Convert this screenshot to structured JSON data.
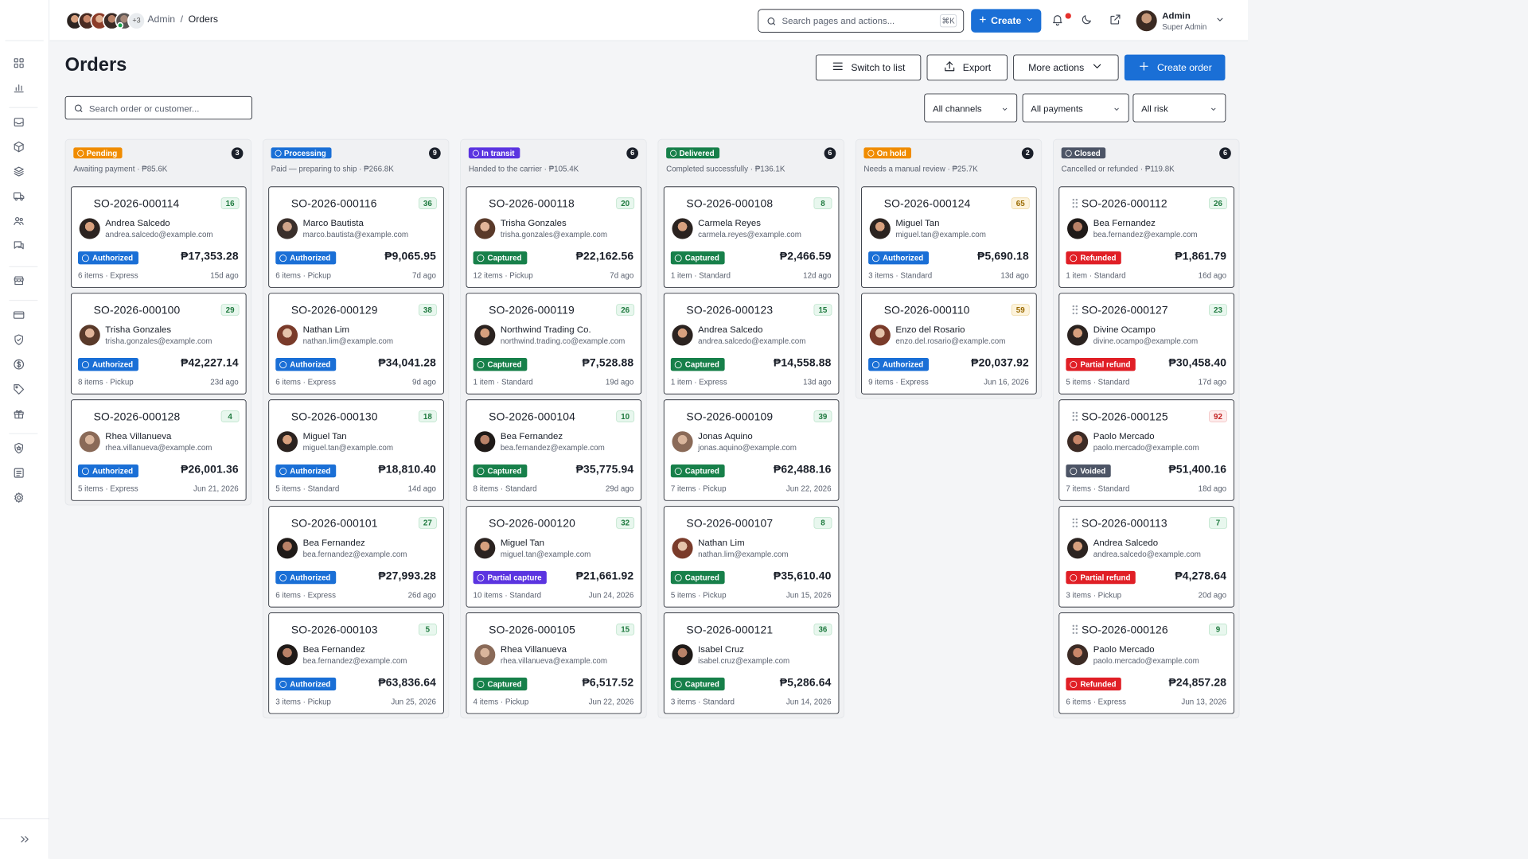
{
  "breadcrumb": {
    "root": "Admin",
    "sep": "/",
    "current": "Orders"
  },
  "avatars": {
    "more": "+3"
  },
  "search": {
    "placeholder": "Search pages and actions...",
    "shortcut": "⌘K"
  },
  "create_button": "Create",
  "user": {
    "name": "Admin",
    "role": "Super Admin"
  },
  "page": {
    "title": "Orders"
  },
  "actions": {
    "switch": "Switch to list",
    "export": "Export",
    "more": "More actions",
    "create_order": "Create order"
  },
  "order_search": {
    "placeholder": "Search order or customer..."
  },
  "filters": {
    "channels": "All channels",
    "payments": "All payments",
    "risk": "All risk"
  },
  "colors": {
    "primary": "#1a6fd6",
    "pending": "#f08c00",
    "processing": "#1a6fd6",
    "in_transit": "#5b34e0",
    "delivered": "#17804a",
    "on_hold": "#f08c00",
    "closed": "#4d5566"
  },
  "columns": [
    {
      "status": "Pending",
      "count": "3",
      "subtitle": "Awaiting payment · ₱85.6K",
      "cards": [
        {
          "id": "SO-2026-000114",
          "score": "16",
          "name": "Andrea Salcedo",
          "email": "andrea.salcedo@example.com",
          "payment": "Authorized",
          "amount": "₱17,353.28",
          "meta": "6 items · Express",
          "age": "15d ago"
        },
        {
          "id": "SO-2026-000100",
          "score": "29",
          "name": "Trisha Gonzales",
          "email": "trisha.gonzales@example.com",
          "payment": "Authorized",
          "amount": "₱42,227.14",
          "meta": "8 items · Pickup",
          "age": "23d ago"
        },
        {
          "id": "SO-2026-000128",
          "score": "4",
          "name": "Rhea Villanueva",
          "email": "rhea.villanueva@example.com",
          "payment": "Authorized",
          "amount": "₱26,001.36",
          "meta": "5 items · Express",
          "age": "Jun 21, 2026"
        }
      ]
    },
    {
      "status": "Processing",
      "count": "9",
      "subtitle": "Paid — preparing to ship · ₱266.8K",
      "cards": [
        {
          "id": "SO-2026-000116",
          "score": "36",
          "name": "Marco Bautista",
          "email": "marco.bautista@example.com",
          "payment": "Authorized",
          "amount": "₱9,065.95",
          "meta": "6 items · Pickup",
          "age": "7d ago"
        },
        {
          "id": "SO-2026-000129",
          "score": "38",
          "name": "Nathan Lim",
          "email": "nathan.lim@example.com",
          "payment": "Authorized",
          "amount": "₱34,041.28",
          "meta": "6 items · Express",
          "age": "9d ago"
        },
        {
          "id": "SO-2026-000130",
          "score": "18",
          "name": "Miguel Tan",
          "email": "miguel.tan@example.com",
          "payment": "Authorized",
          "amount": "₱18,810.40",
          "meta": "5 items · Standard",
          "age": "14d ago"
        },
        {
          "id": "SO-2026-000101",
          "score": "27",
          "name": "Bea Fernandez",
          "email": "bea.fernandez@example.com",
          "payment": "Authorized",
          "amount": "₱27,993.28",
          "meta": "6 items · Express",
          "age": "26d ago"
        },
        {
          "id": "SO-2026-000103",
          "score": "5",
          "name": "Bea Fernandez",
          "email": "bea.fernandez@example.com",
          "payment": "Authorized",
          "amount": "₱63,836.64",
          "meta": "3 items · Pickup",
          "age": "Jun 25, 2026"
        }
      ]
    },
    {
      "status": "In transit",
      "count": "6",
      "subtitle": "Handed to the carrier · ₱105.4K",
      "cards": [
        {
          "id": "SO-2026-000118",
          "score": "20",
          "name": "Trisha Gonzales",
          "email": "trisha.gonzales@example.com",
          "payment": "Captured",
          "amount": "₱22,162.56",
          "meta": "12 items · Pickup",
          "age": "7d ago"
        },
        {
          "id": "SO-2026-000119",
          "score": "26",
          "name": "Northwind Trading Co.",
          "email": "northwind.trading.co@example.com",
          "payment": "Captured",
          "amount": "₱7,528.88",
          "meta": "1 item · Standard",
          "age": "19d ago"
        },
        {
          "id": "SO-2026-000104",
          "score": "10",
          "name": "Bea Fernandez",
          "email": "bea.fernandez@example.com",
          "payment": "Captured",
          "amount": "₱35,775.94",
          "meta": "8 items · Standard",
          "age": "29d ago"
        },
        {
          "id": "SO-2026-000120",
          "score": "32",
          "name": "Miguel Tan",
          "email": "miguel.tan@example.com",
          "payment": "Partial capture",
          "amount": "₱21,661.92",
          "meta": "10 items · Standard",
          "age": "Jun 24, 2026"
        },
        {
          "id": "SO-2026-000105",
          "score": "15",
          "name": "Rhea Villanueva",
          "email": "rhea.villanueva@example.com",
          "payment": "Captured",
          "amount": "₱6,517.52",
          "meta": "4 items · Pickup",
          "age": "Jun 22, 2026"
        }
      ]
    },
    {
      "status": "Delivered",
      "count": "6",
      "subtitle": "Completed successfully · ₱136.1K",
      "cards": [
        {
          "id": "SO-2026-000108",
          "score": "8",
          "name": "Carmela Reyes",
          "email": "carmela.reyes@example.com",
          "payment": "Captured",
          "amount": "₱2,466.59",
          "meta": "1 item · Standard",
          "age": "12d ago"
        },
        {
          "id": "SO-2026-000123",
          "score": "15",
          "name": "Andrea Salcedo",
          "email": "andrea.salcedo@example.com",
          "payment": "Captured",
          "amount": "₱14,558.88",
          "meta": "1 item · Express",
          "age": "13d ago"
        },
        {
          "id": "SO-2026-000109",
          "score": "39",
          "name": "Jonas Aquino",
          "email": "jonas.aquino@example.com",
          "payment": "Captured",
          "amount": "₱62,488.16",
          "meta": "7 items · Pickup",
          "age": "Jun 22, 2026"
        },
        {
          "id": "SO-2026-000107",
          "score": "8",
          "name": "Nathan Lim",
          "email": "nathan.lim@example.com",
          "payment": "Captured",
          "amount": "₱35,610.40",
          "meta": "5 items · Pickup",
          "age": "Jun 15, 2026"
        },
        {
          "id": "SO-2026-000121",
          "score": "36",
          "name": "Isabel Cruz",
          "email": "isabel.cruz@example.com",
          "payment": "Captured",
          "amount": "₱5,286.64",
          "meta": "3 items · Standard",
          "age": "Jun 14, 2026"
        }
      ]
    },
    {
      "status": "On hold",
      "count": "2",
      "subtitle": "Needs a manual review · ₱25.7K",
      "cards": [
        {
          "id": "SO-2026-000124",
          "score": "65",
          "name": "Miguel Tan",
          "email": "miguel.tan@example.com",
          "payment": "Authorized",
          "amount": "₱5,690.18",
          "meta": "3 items · Standard",
          "age": "13d ago"
        },
        {
          "id": "SO-2026-000110",
          "score": "59",
          "name": "Enzo del Rosario",
          "email": "enzo.del.rosario@example.com",
          "payment": "Authorized",
          "amount": "₱20,037.92",
          "meta": "9 items · Express",
          "age": "Jun 16, 2026"
        }
      ]
    },
    {
      "status": "Closed",
      "count": "6",
      "subtitle": "Cancelled or refunded · ₱119.8K",
      "cards": [
        {
          "id": "SO-2026-000112",
          "score": "26",
          "name": "Bea Fernandez",
          "email": "bea.fernandez@example.com",
          "payment": "Refunded",
          "amount": "₱1,861.79",
          "meta": "1 item · Standard",
          "age": "16d ago"
        },
        {
          "id": "SO-2026-000127",
          "score": "23",
          "name": "Divine Ocampo",
          "email": "divine.ocampo@example.com",
          "payment": "Partial refund",
          "amount": "₱30,458.40",
          "meta": "5 items · Standard",
          "age": "17d ago"
        },
        {
          "id": "SO-2026-000125",
          "score": "92",
          "name": "Paolo Mercado",
          "email": "paolo.mercado@example.com",
          "payment": "Voided",
          "amount": "₱51,400.16",
          "meta": "7 items · Standard",
          "age": "18d ago"
        },
        {
          "id": "SO-2026-000113",
          "score": "7",
          "name": "Andrea Salcedo",
          "email": "andrea.salcedo@example.com",
          "payment": "Partial refund",
          "amount": "₱4,278.64",
          "meta": "3 items · Pickup",
          "age": "20d ago"
        },
        {
          "id": "SO-2026-000126",
          "score": "9",
          "name": "Paolo Mercado",
          "email": "paolo.mercado@example.com",
          "payment": "Refunded",
          "amount": "₱24,857.28",
          "meta": "6 items · Express",
          "age": "Jun 13, 2026"
        }
      ]
    }
  ]
}
